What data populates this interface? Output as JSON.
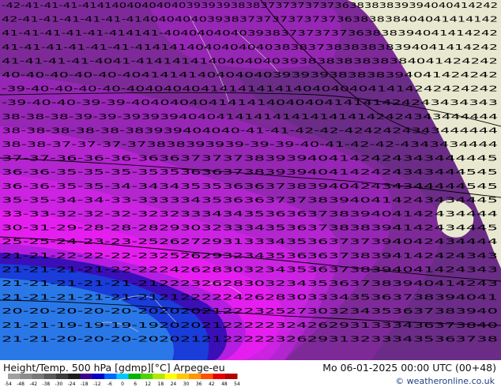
{
  "header": {
    "left_title": "Height/Temp. 500 hPa [gdmp][°C] Arpege-eu",
    "right_title": "Mo 06-01-2025 00:00 UTC (00+48)",
    "credit": "© weatheronline.co.uk"
  },
  "colorbar": {
    "ticks": [
      "-54",
      "-48",
      "-42",
      "-38",
      "-30",
      "-24",
      "-18",
      "-12",
      "-6",
      "0",
      "6",
      "12",
      "18",
      "24",
      "30",
      "36",
      "42",
      "48",
      "54"
    ],
    "colors": [
      "#a0a0a0",
      "#8c8c8c",
      "#787878",
      "#5a5a5a",
      "#3c3c3c",
      "#1e1e1e",
      "#3c0090",
      "#0000c8",
      "#0064ff",
      "#00c8ff",
      "#00b400",
      "#50d200",
      "#b4e600",
      "#ffff00",
      "#ffc800",
      "#ff9600",
      "#ff5000",
      "#e60000",
      "#b40000"
    ]
  },
  "map": {
    "colors": {
      "band_45": "#6a2c86",
      "band_42": "#7d2a98",
      "band_39": "#9626b4",
      "band_36": "#b325cf",
      "band_33": "#cc22e2",
      "band_30": "#e51ef0",
      "band_27": "#b41ee0",
      "band_24": "#3a0fb8",
      "band_21": "#1a3cd8",
      "band_18": "#2a78e8",
      "land": "#e8e8d0"
    },
    "contour_labels": [
      {
        "row": 1,
        "text": "-42-41-41-41-41414040404040393939383837373737373638383839394040414242"
      },
      {
        "row": 2,
        "text": "42-41-41-41-41-41-4140404040393837373737373736383838404041414142"
      },
      {
        "row": 3,
        "text": "41-41-41-41-41-414141-4040404040393837373737363838394041414242"
      },
      {
        "row": 4,
        "text": "41-41-41-41-41-41-414141404040404038383738383838394041414242"
      },
      {
        "row": 5,
        "text": "41-41-41-41-4041-4141414140404040393838383838384041424242"
      },
      {
        "row": 6,
        "text": "40-40-40-40-40-4041414140404040393939383838394041424242"
      },
      {
        "row": 7,
        "text": "-39-40-40-40-40-4040404041414141414040404041414242424242"
      },
      {
        "row": 8,
        "text": "-39-40-40-39-39-40404040414141404040414141424243434343"
      },
      {
        "row": 9,
        "text": "38-38-38-39-39-3939394040414141414141414142424343444444"
      },
      {
        "row": 10,
        "text": "38-38-38-38-38-383939404040-41-41-42-42-4242424343444444"
      },
      {
        "row": 11,
        "text": "38-38-37-37-37-373838393939-39-39-40-41-42-42-4343434444"
      },
      {
        "row": 12,
        "text": "37-37-36-36-36-3636373737383939404142424343444445"
      },
      {
        "row": 13,
        "text": "36-36-35-35-35-3535363637383939404142424343444545"
      },
      {
        "row": 14,
        "text": "36-36-35-35-34-3434353536363738394042434344444545"
      },
      {
        "row": 15,
        "text": "35-35-34-34-33-3333343536363737383940414243434445"
      },
      {
        "row": 16,
        "text": "33-33-32-32-32-3232333434353636373839404142434444"
      },
      {
        "row": 17,
        "text": "30-31-29-28-28-2829303233343536373838394142434445"
      },
      {
        "row": 18,
        "text": "25-25-24-23-23-2526272931333435363737394042434444"
      },
      {
        "row": 19,
        "text": "21-21-22-22-22-2325262932343536363738394142424343"
      },
      {
        "row": 20,
        "text": "21-21-21-21-22-2224262830323435363738394041424343"
      },
      {
        "row": 21,
        "text": "21-21-21-21-21-2122232628303234353637383940414243"
      },
      {
        "row": 22,
        "text": "21-21-21-21-21-2121222224262830333435363738394041"
      },
      {
        "row": 23,
        "text": "20-20-20-20-20-2020202122232527303234353637383940"
      },
      {
        "row": 24,
        "text": "21-21-19-19-19-1920202122222324262931333436373840"
      },
      {
        "row": 25,
        "text": "21-21-20-20-20-2020212122222326293132333435363738"
      }
    ]
  }
}
